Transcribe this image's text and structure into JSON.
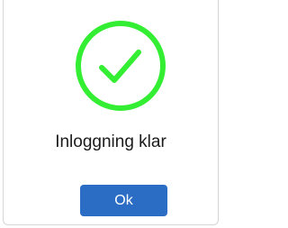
{
  "dialog": {
    "icon": "success-check-icon",
    "icon_color": "#33ee33",
    "message": "Inloggning klar",
    "ok_label": "Ok",
    "button_color": "#2b6cc4"
  }
}
